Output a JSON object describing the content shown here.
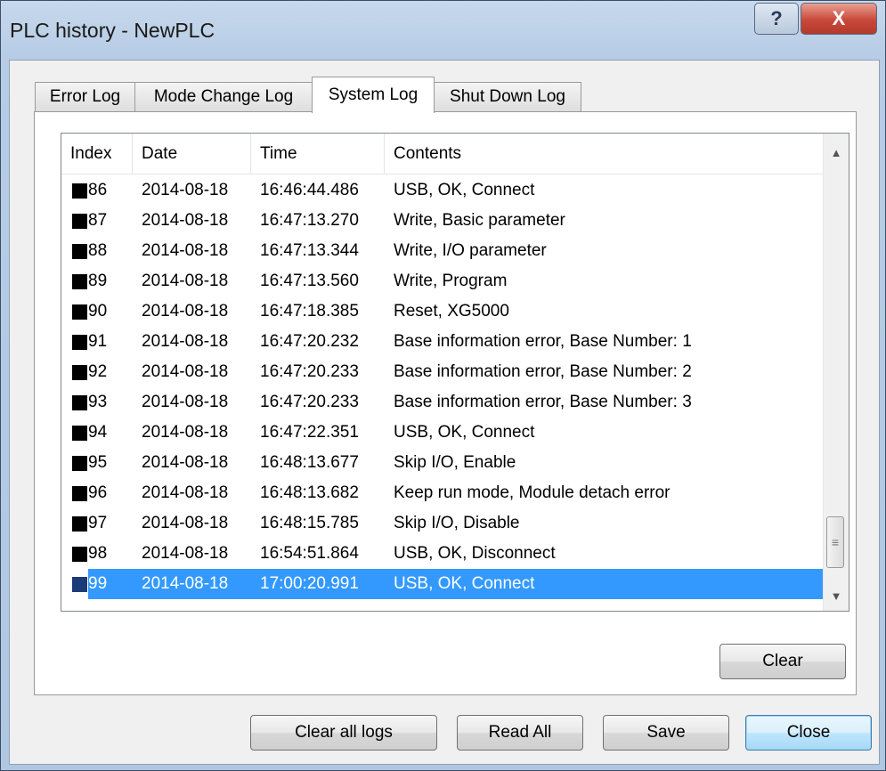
{
  "window": {
    "title": "PLC history - NewPLC",
    "help_label": "?",
    "close_label": "X"
  },
  "tabs": [
    {
      "label": "Error Log",
      "active": false
    },
    {
      "label": "Mode Change Log",
      "active": false
    },
    {
      "label": "System Log",
      "active": true
    },
    {
      "label": "Shut Down Log",
      "active": false
    }
  ],
  "list": {
    "columns": [
      "Index",
      "Date",
      "Time",
      "Contents"
    ],
    "rows": [
      {
        "index": "86",
        "date": "2014-08-18",
        "time": "16:46:44.486",
        "contents": "USB, OK, Connect"
      },
      {
        "index": "87",
        "date": "2014-08-18",
        "time": "16:47:13.270",
        "contents": "Write, Basic parameter"
      },
      {
        "index": "88",
        "date": "2014-08-18",
        "time": "16:47:13.344",
        "contents": "Write, I/O parameter"
      },
      {
        "index": "89",
        "date": "2014-08-18",
        "time": "16:47:13.560",
        "contents": "Write, Program"
      },
      {
        "index": "90",
        "date": "2014-08-18",
        "time": "16:47:18.385",
        "contents": "Reset, XG5000"
      },
      {
        "index": "91",
        "date": "2014-08-18",
        "time": "16:47:20.232",
        "contents": "Base information error, Base Number: 1"
      },
      {
        "index": "92",
        "date": "2014-08-18",
        "time": "16:47:20.233",
        "contents": "Base information error, Base Number: 2"
      },
      {
        "index": "93",
        "date": "2014-08-18",
        "time": "16:47:20.233",
        "contents": "Base information error, Base Number: 3"
      },
      {
        "index": "94",
        "date": "2014-08-18",
        "time": "16:47:22.351",
        "contents": "USB, OK, Connect"
      },
      {
        "index": "95",
        "date": "2014-08-18",
        "time": "16:48:13.677",
        "contents": "Skip I/O, Enable"
      },
      {
        "index": "96",
        "date": "2014-08-18",
        "time": "16:48:13.682",
        "contents": "Keep run mode, Module detach error"
      },
      {
        "index": "97",
        "date": "2014-08-18",
        "time": "16:48:15.785",
        "contents": "Skip I/O, Disable"
      },
      {
        "index": "98",
        "date": "2014-08-18",
        "time": "16:54:51.864",
        "contents": "USB, OK, Disconnect"
      },
      {
        "index": "99",
        "date": "2014-08-18",
        "time": "17:00:20.991",
        "contents": "USB, OK, Connect",
        "selected": true
      }
    ]
  },
  "buttons": {
    "clear": "Clear",
    "clear_all_logs": "Clear all logs",
    "read_all": "Read All",
    "save": "Save",
    "close": "Close"
  },
  "colors": {
    "selection": "#3399ff",
    "title_bar": "#b7cde6",
    "close_button": "#c9483a"
  }
}
